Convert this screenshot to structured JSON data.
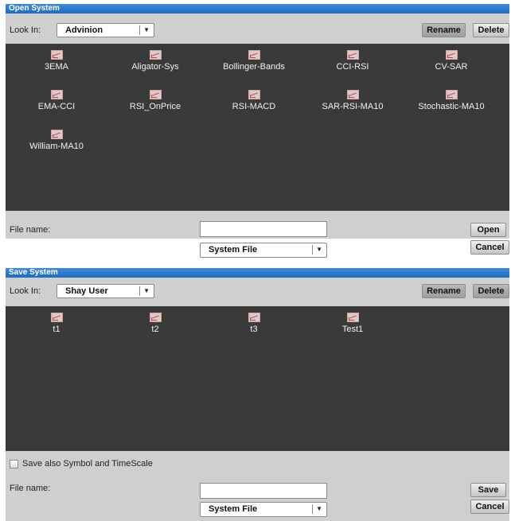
{
  "open_dialog": {
    "title": "Open System",
    "look_in_label": "Look In:",
    "look_in_value": "Advinion",
    "rename_label": "Rename",
    "delete_label": "Delete",
    "files": [
      "3EMA",
      "Aligator-Sys",
      "Bollinger-Bands",
      "CCI-RSI",
      "CV-SAR",
      "EMA-CCI",
      "RSI_OnPrice",
      "RSI-MACD",
      "SAR-RSI-MA10",
      "Stochastic-MA10",
      "William-MA10"
    ],
    "file_name_label": "File name:",
    "file_name_value": "",
    "file_type_value": "System File",
    "open_label": "Open",
    "cancel_label": "Cancel"
  },
  "save_dialog": {
    "title": "Save System",
    "look_in_label": "Look In:",
    "look_in_value": "Shay User",
    "rename_label": "Rename",
    "delete_label": "Delete",
    "files": [
      "t1",
      "t2",
      "t3",
      "Test1"
    ],
    "save_also_label": "Save also Symbol and TimeScale",
    "save_also_checked": false,
    "file_name_label": "File name:",
    "file_name_value": "",
    "file_type_value": "System File",
    "save_label": "Save",
    "cancel_label": "Cancel"
  },
  "icons": {
    "file_icon": "system-file-icon",
    "dropdown_icon": "chevron-down-icon"
  },
  "colors": {
    "titlebar": "#1f6cc0",
    "panel": "#cfcfcf",
    "file_area": "#3a3a3a"
  }
}
